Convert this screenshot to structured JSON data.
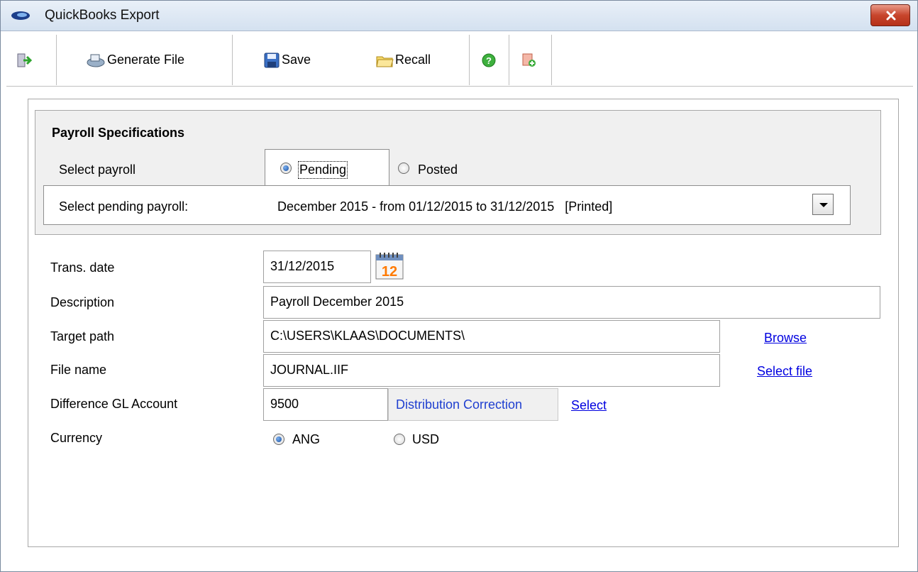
{
  "window": {
    "title": "QuickBooks Export"
  },
  "toolbar": {
    "generate_label": "Generate File",
    "save_label": "Save",
    "recall_label": "Recall"
  },
  "specs": {
    "title": "Payroll Specifications",
    "select_payroll_label": "Select payroll",
    "options": {
      "pending": "Pending",
      "posted": "Posted"
    },
    "selected_option": "Pending",
    "pending_label": "Select pending payroll:",
    "pending_value": "December 2015 - from 01/12/2015 to 31/12/2015   [Printed]"
  },
  "form": {
    "trans_date_label": "Trans. date",
    "trans_date": "31/12/2015",
    "calendar_day": "12",
    "description_label": "Description",
    "description": "Payroll December 2015",
    "target_path_label": "Target path",
    "target_path": "C:\\USERS\\KLAAS\\DOCUMENTS\\",
    "browse_link": "Browse",
    "file_name_label": "File name",
    "file_name": "JOURNAL.IIF",
    "select_file_link": "Select file",
    "gl_label": "Difference GL Account",
    "gl_account": "9500",
    "gl_account_name": "Distribution Correction",
    "gl_select_link": "Select",
    "currency_label": "Currency",
    "currency_options": [
      "ANG",
      "USD"
    ],
    "currency_selected": "ANG"
  },
  "colors": {
    "link": "#0000e0",
    "title_gradient": "#d4e1f0",
    "close_button": "#c7452c"
  },
  "icons": [
    "app-logo-icon",
    "close-icon",
    "exit-icon",
    "generate-file-icon",
    "save-icon",
    "recall-folder-icon",
    "help-icon",
    "add-document-icon",
    "calendar-icon",
    "dropdown-arrow-icon"
  ]
}
